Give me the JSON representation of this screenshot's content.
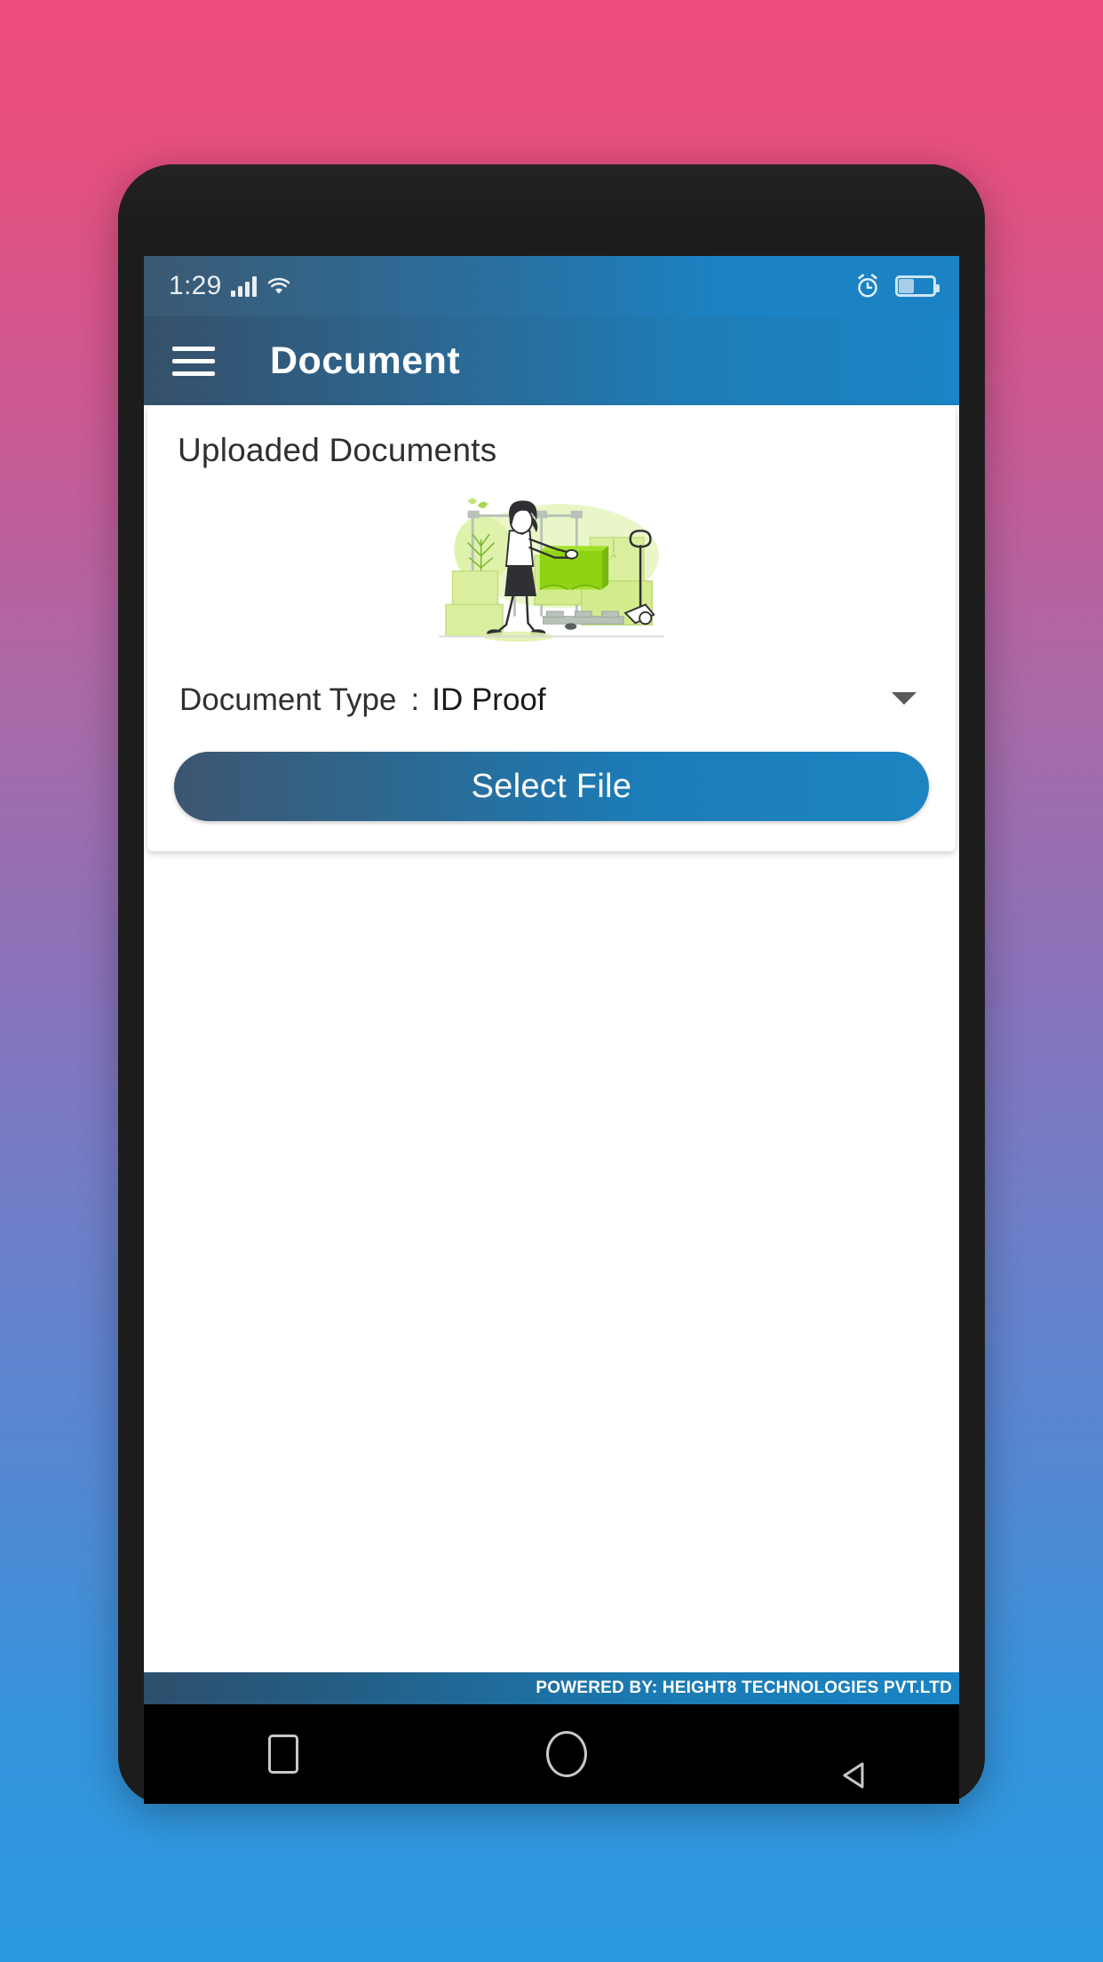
{
  "status_bar": {
    "time": "1:29",
    "icons": [
      "signal-icon",
      "wifi-icon",
      "alarm-icon",
      "battery-icon"
    ],
    "battery_level_percent": 42
  },
  "app_bar": {
    "menu_icon": "hamburger-menu-icon",
    "title": "Document"
  },
  "card": {
    "section_title": "Uploaded Documents",
    "illustration_name": "warehouse-package-illustration",
    "document_type": {
      "label": "Document Type",
      "separator": ":",
      "selected_value": "ID Proof",
      "caret_icon": "chevron-down-icon"
    },
    "select_file_label": "Select File"
  },
  "footer": {
    "powered_by": "POWERED BY: HEIGHT8 TECHNOLOGIES PVT.LTD"
  },
  "nav_bar": {
    "recents_icon": "square-recents-icon",
    "home_icon": "circle-home-icon",
    "back_icon": "triangle-back-icon"
  },
  "colors": {
    "background_top": "#ef4d7e",
    "background_bottom": "#2c9ae0",
    "app_bar_start": "#36506a",
    "app_bar_end": "#1a84c6",
    "button_start": "#3d5670",
    "button_end": "#1d84c2",
    "device_body": "#1c1c1c"
  }
}
